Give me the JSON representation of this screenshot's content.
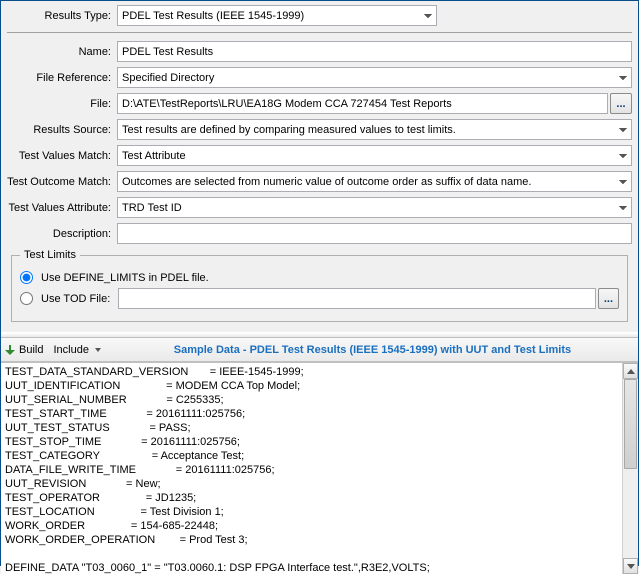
{
  "results_type": {
    "label": "Results Type:",
    "value": "PDEL Test Results (IEEE 1545-1999)"
  },
  "form": {
    "name": {
      "label": "Name:",
      "value": "PDEL Test Results"
    },
    "file_reference": {
      "label": "File Reference:",
      "value": "Specified Directory"
    },
    "file": {
      "label": "File:",
      "value": "D:\\ATE\\TestReports\\LRU\\EA18G Modem CCA 727454 Test Reports"
    },
    "results_source": {
      "label": "Results Source:",
      "value": "Test results are defined by comparing measured values to test limits."
    },
    "test_values_match": {
      "label": "Test Values Match:",
      "value": "Test Attribute"
    },
    "test_outcome_match": {
      "label": "Test Outcome Match:",
      "value": "Outcomes are selected from numeric value of outcome order as suffix of data name."
    },
    "test_values_attribute": {
      "label": "Test Values Attribute:",
      "value": "TRD Test ID"
    },
    "description": {
      "label": "Description:",
      "value": ""
    }
  },
  "test_limits": {
    "legend": "Test Limits",
    "option_pdel": "Use DEFINE_LIMITS in PDEL file.",
    "option_tod": "Use TOD File:",
    "tod_value": ""
  },
  "toolbar": {
    "build": "Build",
    "include": "Include",
    "title": "Sample Data - PDEL Test Results (IEEE 1545-1999) with UUT and Test Limits"
  },
  "ellipsis": "...",
  "sample_text": "TEST_DATA_STANDARD_VERSION       = IEEE-1545-1999;\nUUT_IDENTIFICATION               = MODEM CCA Top Model;\nUUT_SERIAL_NUMBER             = C255335;\nTEST_START_TIME             = 20161111:025756;\nUUT_TEST_STATUS             = PASS;\nTEST_STOP_TIME             = 20161111:025756;\nTEST_CATEGORY                 = Acceptance Test;\nDATA_FILE_WRITE_TIME             = 20161111:025756;\nUUT_REVISION             = New;\nTEST_OPERATOR               = JD1235;\nTEST_LOCATION               = Test Division 1;\nWORK_ORDER               = 154-685-22448;\nWORK_ORDER_OPERATION        = Prod Test 3;\n\nDEFINE_DATA \"T03_0060_1\" = \"T03.0060.1: DSP FPGA Interface test.\",R3E2,VOLTS;"
}
